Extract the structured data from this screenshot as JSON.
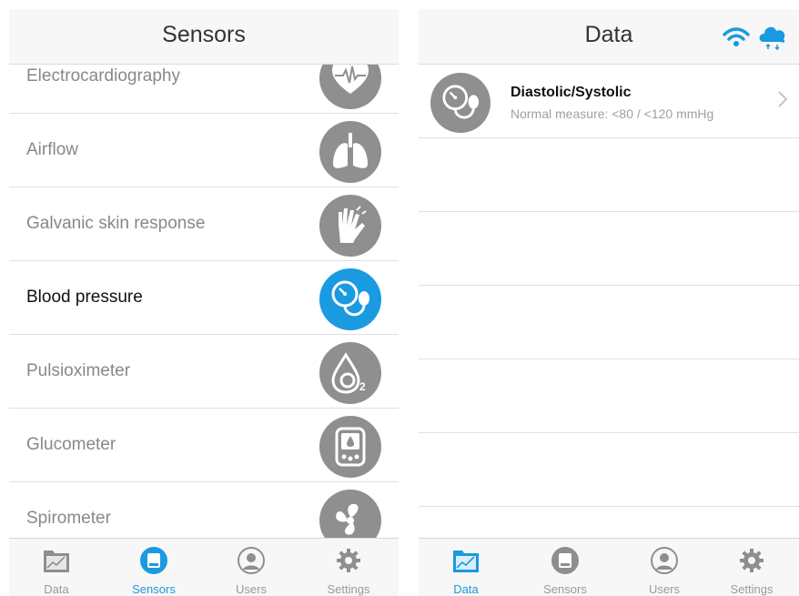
{
  "sensors_screen": {
    "title": "Sensors",
    "items": [
      {
        "label": "Electrocardiography",
        "icon": "heart-ecg-icon",
        "active": false
      },
      {
        "label": "Airflow",
        "icon": "lungs-icon",
        "active": false
      },
      {
        "label": "Galvanic skin response",
        "icon": "hand-icon",
        "active": false
      },
      {
        "label": "Blood pressure",
        "icon": "blood-pressure-icon",
        "active": true
      },
      {
        "label": "Pulsioximeter",
        "icon": "oxygen-drop-icon",
        "active": false
      },
      {
        "label": "Glucometer",
        "icon": "glucometer-icon",
        "active": false
      },
      {
        "label": "Spirometer",
        "icon": "spirometer-fan-icon",
        "active": false
      }
    ],
    "tabs": [
      {
        "label": "Data",
        "icon": "chart-folder-icon"
      },
      {
        "label": "Sensors",
        "icon": "sensor-chip-icon"
      },
      {
        "label": "Users",
        "icon": "user-icon"
      },
      {
        "label": "Settings",
        "icon": "gear-icon"
      }
    ],
    "active_tab": "Sensors"
  },
  "data_screen": {
    "title": "Data",
    "status_icons": [
      "wifi-icon",
      "cloud-sync-icon"
    ],
    "rows": [
      {
        "title": "Diastolic/Systolic",
        "subtitle": "Normal measure: <80 / <120 mmHg",
        "icon": "blood-pressure-icon"
      }
    ],
    "tabs": [
      {
        "label": "Data",
        "icon": "chart-folder-icon"
      },
      {
        "label": "Sensors",
        "icon": "sensor-chip-icon"
      },
      {
        "label": "Users",
        "icon": "user-icon"
      },
      {
        "label": "Settings",
        "icon": "gear-icon"
      }
    ],
    "active_tab": "Data"
  },
  "colors": {
    "accent": "#1a9ae0",
    "icon_gray": "#8f8f8f",
    "bar_bg": "#f7f7f7",
    "separator": "#e0e0e0"
  }
}
